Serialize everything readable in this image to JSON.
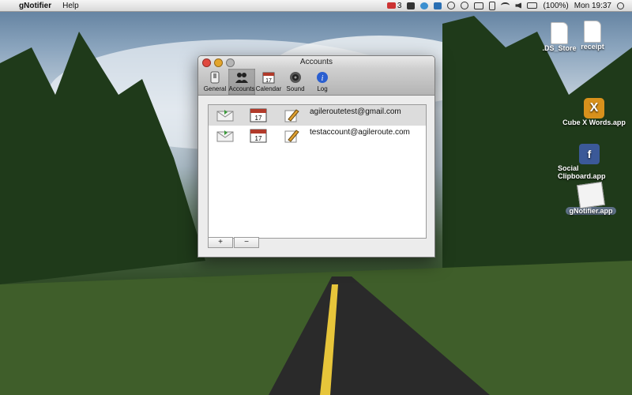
{
  "menubar": {
    "app_name": "gNotifier",
    "menu_help": "Help",
    "mail_count": "3",
    "battery": "(100%)",
    "clock": "Mon 19:37"
  },
  "window": {
    "title": "Accounts",
    "toolbar": [
      {
        "label": "General",
        "icon": "switch-icon"
      },
      {
        "label": "Accounts",
        "icon": "users-icon"
      },
      {
        "label": "Calendar",
        "icon": "calendar-icon"
      },
      {
        "label": "Sound",
        "icon": "speaker-icon"
      },
      {
        "label": "Log",
        "icon": "info-icon"
      }
    ],
    "accounts": [
      {
        "email": "agileroutetest@gmail.com",
        "calendar_day": "17"
      },
      {
        "email": "testaccount@agileroute.com",
        "calendar_day": "17"
      }
    ],
    "add_label": "+",
    "remove_label": "−"
  },
  "desktop_icons": [
    {
      "label": ".DS_Store"
    },
    {
      "label": "receipt"
    },
    {
      "label": "Cube X Words.app"
    },
    {
      "label": "Social Clipboard.app"
    },
    {
      "label": "gNotifier.app"
    }
  ],
  "colors": {
    "accent_info": "#2a5fd0",
    "close": "#e0493f",
    "minimize": "#e3a52c"
  }
}
